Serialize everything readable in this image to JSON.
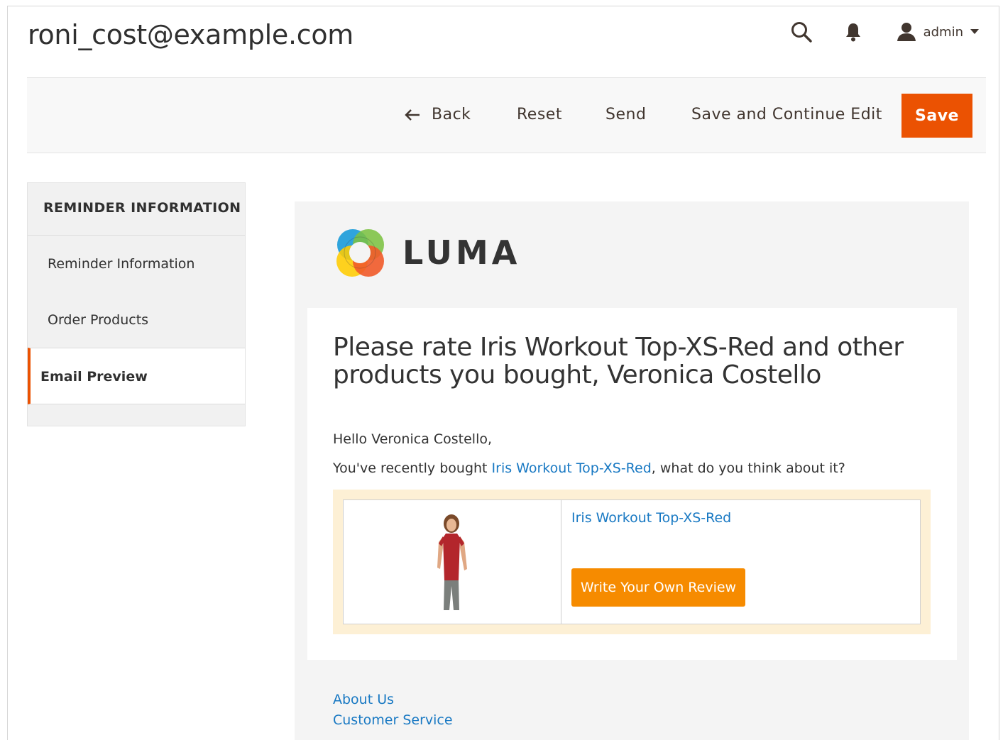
{
  "header": {
    "title": "roni_cost@example.com",
    "user_label": "admin"
  },
  "actions": {
    "back": "Back",
    "reset": "Reset",
    "send": "Send",
    "save_continue": "Save and Continue Edit",
    "save": "Save"
  },
  "sidebar": {
    "title": "REMINDER INFORMATION",
    "items": [
      {
        "label": "Reminder Information"
      },
      {
        "label": "Order Products"
      },
      {
        "label": "Email Preview",
        "active": true
      }
    ]
  },
  "email": {
    "brand": "LUMA",
    "heading": "Please rate Iris Workout Top-XS-Red and other products you bought, Veronica Costello",
    "greeting": "Hello Veronica Costello,",
    "bought_prefix": "You've recently bought ",
    "bought_product": "Iris Workout Top-XS-Red",
    "bought_suffix": ", what do you think about it?",
    "product": {
      "name": "Iris Workout Top-XS-Red",
      "review_button": "Write Your Own Review"
    },
    "footer_links": [
      "About Us",
      "Customer Service"
    ]
  },
  "colors": {
    "accent": "#eb5202",
    "review_button": "#f68b00",
    "link": "#1979c3"
  }
}
